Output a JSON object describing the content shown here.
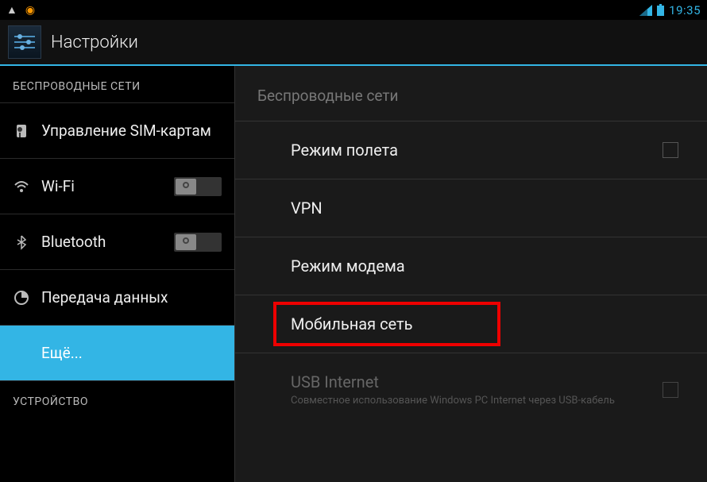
{
  "status": {
    "time": "19:35"
  },
  "header": {
    "title": "Настройки"
  },
  "sidebar": {
    "section1": "БЕСПРОВОДНЫЕ СЕТИ",
    "sim": "Управление SIM-картам",
    "wifi": "Wi-Fi",
    "bluetooth": "Bluetooth",
    "data": "Передача данных",
    "more": "Ещё...",
    "section2": "УСТРОЙСТВО"
  },
  "panel": {
    "header": "Беспроводные сети",
    "airplane": "Режим полета",
    "vpn": "VPN",
    "tether": "Режим модема",
    "mobile": "Мобильная сеть",
    "usb_title": "USB Internet",
    "usb_sub": "Совместное использование Windows PC Internet через USB-кабель"
  }
}
